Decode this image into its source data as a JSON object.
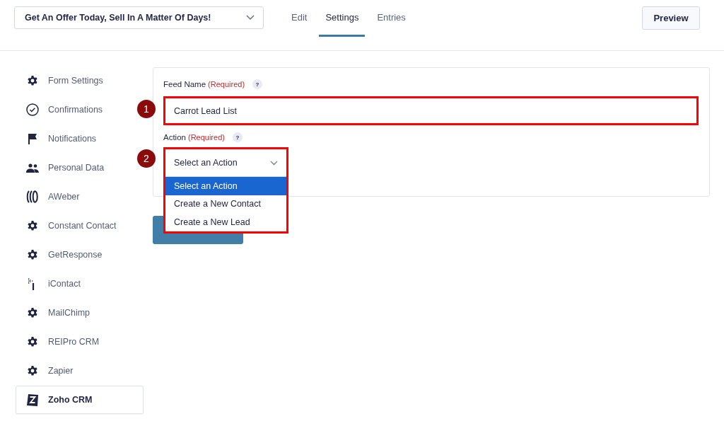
{
  "form_select": {
    "value": "Get An Offer Today, Sell In A Matter Of Days!"
  },
  "tabs": [
    {
      "label": "Edit",
      "selected": false
    },
    {
      "label": "Settings",
      "selected": true
    },
    {
      "label": "Entries",
      "selected": false
    }
  ],
  "preview_button": "Preview",
  "sidebar": {
    "items": [
      {
        "label": "Form Settings",
        "kind": "gear",
        "selected": false
      },
      {
        "label": "Confirmations",
        "kind": "check",
        "selected": false
      },
      {
        "label": "Notifications",
        "kind": "flag",
        "selected": false
      },
      {
        "label": "Personal Data",
        "kind": "people",
        "selected": false
      },
      {
        "label": "AWeber",
        "kind": "waves",
        "selected": false
      },
      {
        "label": "Constant Contact",
        "kind": "gear",
        "selected": false
      },
      {
        "label": "GetResponse",
        "kind": "gear",
        "selected": false
      },
      {
        "label": "iContact",
        "kind": "signal",
        "selected": false
      },
      {
        "label": "MailChimp",
        "kind": "gear",
        "selected": false
      },
      {
        "label": "REIPro CRM",
        "kind": "gear",
        "selected": false
      },
      {
        "label": "Zapier",
        "kind": "gear",
        "selected": false
      },
      {
        "label": "Zoho CRM",
        "kind": "zoho",
        "selected": true
      }
    ]
  },
  "feed_name": {
    "label": "Feed Name",
    "required": "(Required)",
    "help": "?",
    "value": "Carrot Lead List",
    "marker": "1"
  },
  "action": {
    "label": "Action",
    "required": "(Required)",
    "help": "?",
    "value": "Select an Action",
    "marker": "2",
    "expanded": true,
    "options": [
      {
        "label": "Select an Action",
        "selected": true
      },
      {
        "label": "Create a New Contact",
        "selected": false
      },
      {
        "label": "Create a New Lead",
        "selected": false
      }
    ]
  }
}
